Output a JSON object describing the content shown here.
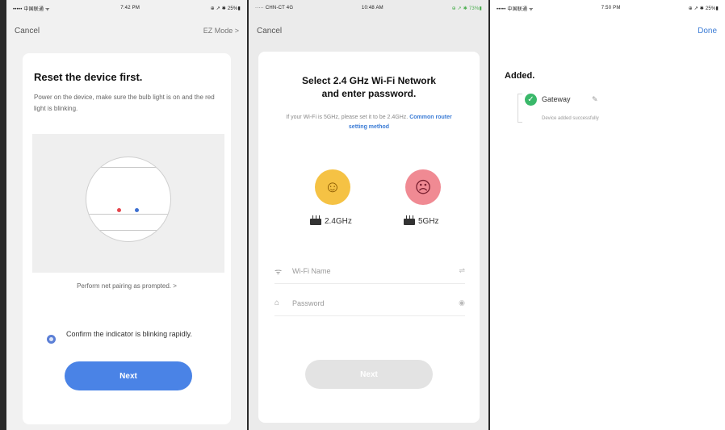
{
  "screen1": {
    "status": {
      "left": "••••• 中国联通 ᯤ",
      "time": "7:42 PM",
      "right": "⊕ ↗ ✱ 25%▮"
    },
    "nav": {
      "cancel": "Cancel",
      "mode": "EZ Mode >"
    },
    "title": "Reset the device first.",
    "description": "Power on the device, make sure the bulb light is on and the red light is blinking.",
    "hint": "Perform net pairing as prompted. >",
    "confirm": "Confirm the indicator is blinking rapidly.",
    "next": "Next"
  },
  "screen2": {
    "status": {
      "left": "····· CHN-CT 4G",
      "time": "10:48 AM",
      "right": "⊕ ↗ ✱ 73%▮"
    },
    "nav": {
      "cancel": "Cancel"
    },
    "title_line1": "Select 2.4 GHz Wi-Fi Network",
    "title_line2": "and enter password.",
    "desc_prefix": "If your Wi-Fi is 5GHz, please set it to be 2.4GHz.",
    "desc_link": "Common router setting method",
    "band_24": "2.4GHz",
    "band_5": "5GHz",
    "wifi_placeholder": "Wi-Fi Name",
    "wifi_tail": "⇌",
    "password_placeholder": "Password",
    "password_tail": "◉",
    "next": "Next"
  },
  "screen3": {
    "status": {
      "left": "••••• 中国联通 ᯤ",
      "time": "7:50 PM",
      "right": "⊕ ↗ ✱ 25%▮"
    },
    "nav": {
      "done": "Done"
    },
    "added": "Added.",
    "device_name": "Gateway",
    "device_sub": "Device added successfully"
  },
  "colors": {
    "accent": "#4a83e6",
    "link": "#3a7bd5",
    "success": "#3ab86a",
    "happy": "#f5c244",
    "sad": "#f08a93"
  },
  "icons": {
    "happy": "☺",
    "sad": "☹",
    "wifi": "ᯤ",
    "lock": "⌂",
    "check": "✓",
    "pencil": "✎"
  }
}
